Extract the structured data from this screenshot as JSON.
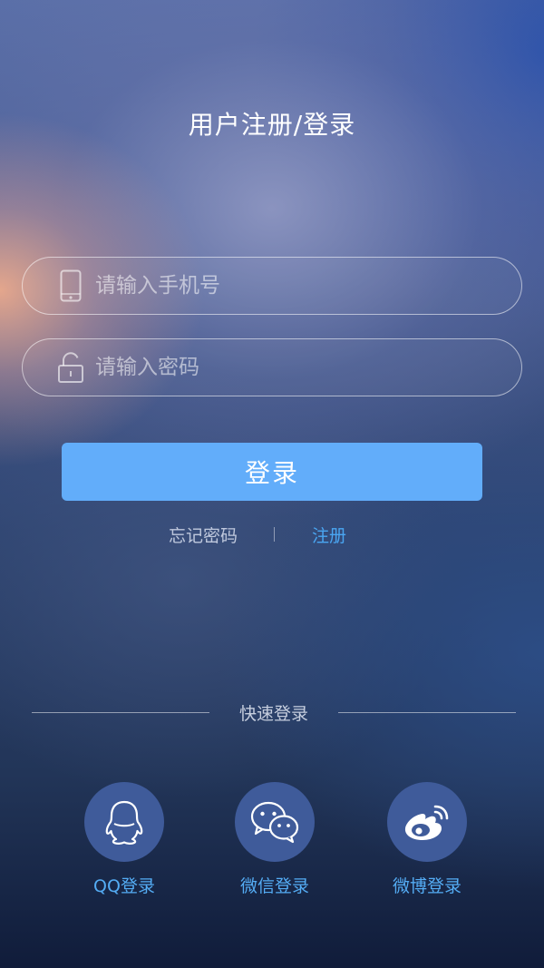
{
  "header": {
    "title": "用户注册/登录"
  },
  "form": {
    "phone": {
      "placeholder": "请输入手机号",
      "value": "",
      "icon": "phone-icon"
    },
    "password": {
      "placeholder": "请输入密码",
      "value": "",
      "icon": "lock-icon"
    },
    "login_label": "登录"
  },
  "links": {
    "forgot_label": "忘记密码",
    "separator": "|",
    "register_label": "注册"
  },
  "quick_login": {
    "label": "快速登录",
    "options": [
      {
        "label": "QQ登录",
        "icon": "qq-icon"
      },
      {
        "label": "微信登录",
        "icon": "wechat-icon"
      },
      {
        "label": "微博登录",
        "icon": "weibo-icon"
      }
    ]
  },
  "colors": {
    "button": "#62adfa",
    "link_accent": "#4aa6f2",
    "social_circle": "#3f5b9a",
    "social_label": "#54acf4"
  }
}
